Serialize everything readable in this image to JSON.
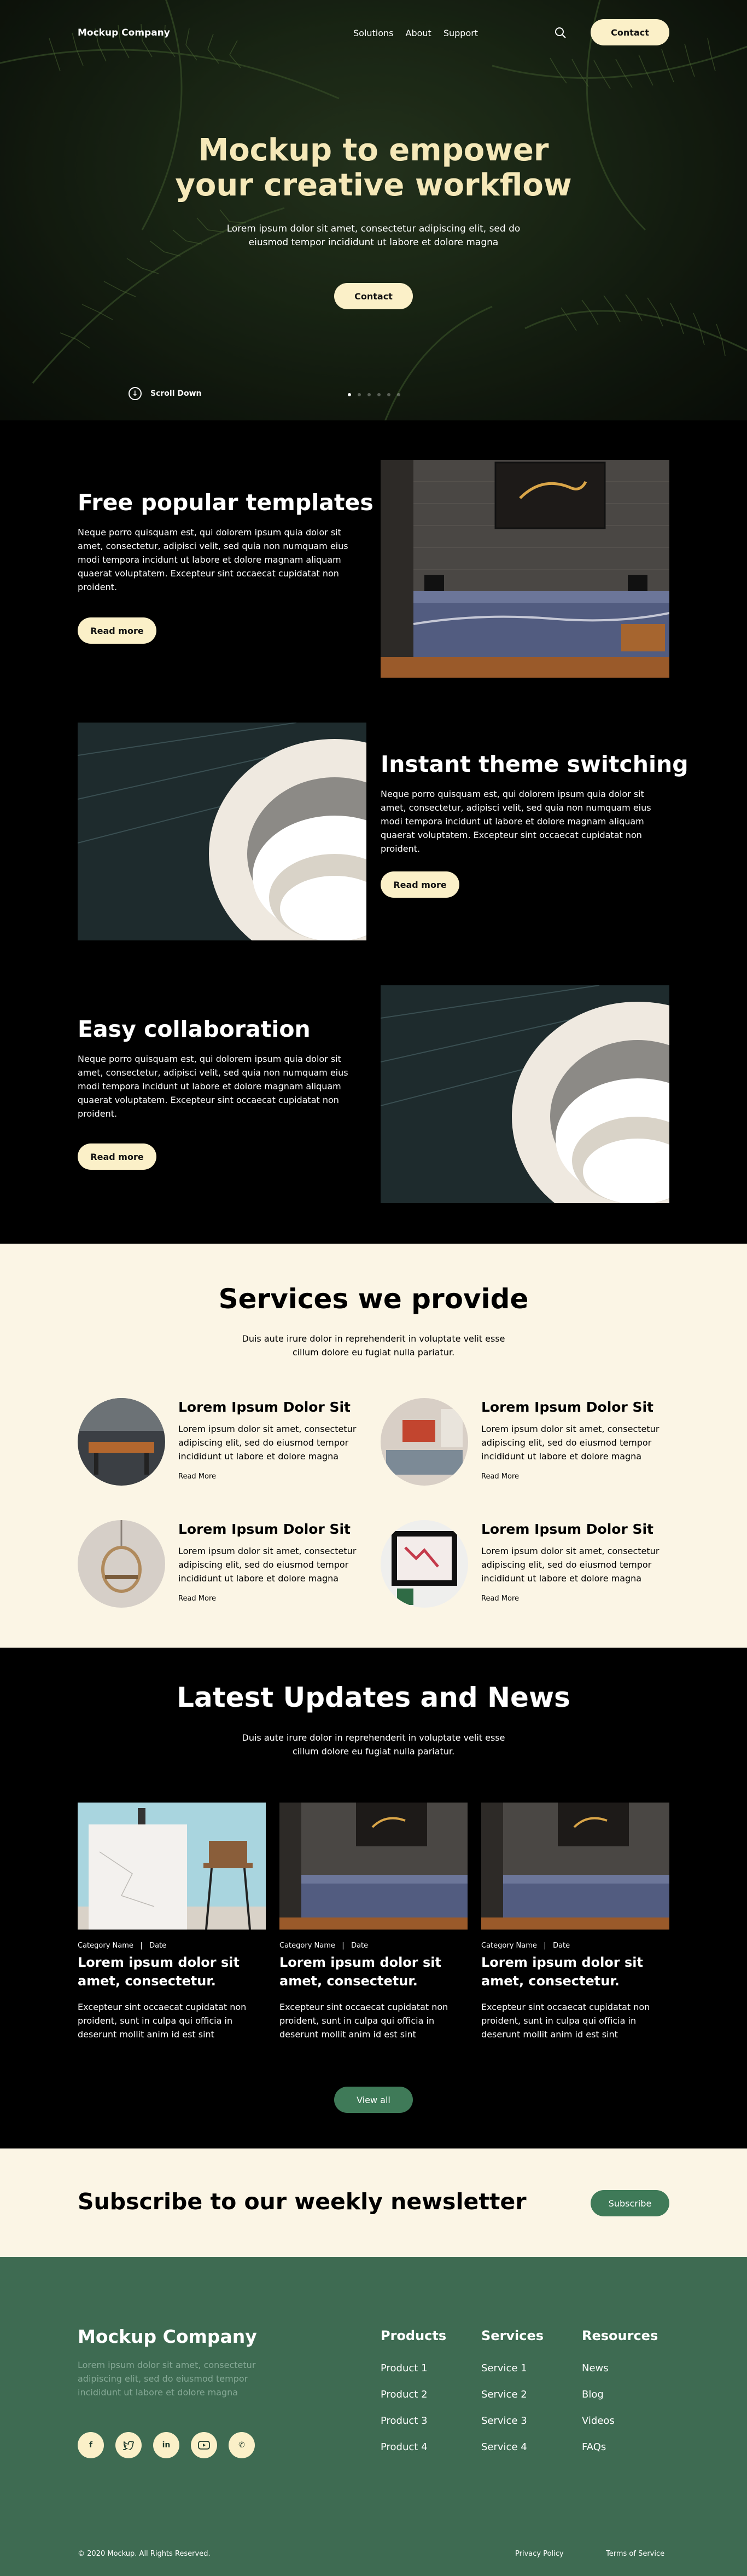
{
  "header": {
    "brand": "Mockup Company",
    "menu": [
      "Solutions",
      "About",
      "Support"
    ],
    "contact_label": "Contact"
  },
  "hero": {
    "title": "Mockup to empower your creative workflow",
    "subtitle": "Lorem ipsum dolor sit amet, consectetur adipiscing elit, sed do eiusmod tempor incididunt ut labore et dolore magna",
    "cta_label": "Contact",
    "scroll_label": "Scroll Down",
    "slides": 6,
    "active_slide": 1
  },
  "features": [
    {
      "title": "Free popular templates",
      "text": "Neque porro quisquam est, qui dolorem ipsum quia dolor sit amet, consectetur, adipisci velit, sed quia non numquam eius modi tempora incidunt ut labore et dolore magnam aliquam quaerat voluptatem. Excepteur sint occaecat cupidatat non proident.",
      "button": "Read more"
    },
    {
      "title": "Instant theme switching",
      "text": "Neque porro quisquam est, qui dolorem ipsum quia dolor sit amet, consectetur, adipisci velit, sed quia non numquam eius modi tempora incidunt ut labore et dolore magnam aliquam quaerat voluptatem. Excepteur sint occaecat cupidatat non proident.",
      "button": "Read more"
    },
    {
      "title": "Easy collaboration",
      "text": "Neque porro quisquam est, qui dolorem ipsum quia dolor sit amet, consectetur, adipisci velit, sed quia non numquam eius modi tempora incidunt ut labore et dolore magnam aliquam quaerat voluptatem. Excepteur sint occaecat cupidatat non proident.",
      "button": "Read more"
    }
  ],
  "services": {
    "title": "Services we provide",
    "subtitle": "Duis aute irure dolor in reprehenderit in voluptate velit esse cillum dolore eu fugiat nulla pariatur.",
    "items": [
      {
        "title": "Lorem Ipsum Dolor Sit",
        "text": "Lorem ipsum dolor sit amet, consectetur adipiscing elit, sed do eiusmod tempor incididunt ut labore et dolore magna",
        "link": "Read More"
      },
      {
        "title": "Lorem Ipsum Dolor Sit",
        "text": "Lorem ipsum dolor sit amet, consectetur adipiscing elit, sed do eiusmod tempor incididunt ut labore et dolore magna",
        "link": "Read More"
      },
      {
        "title": "Lorem Ipsum Dolor Sit",
        "text": "Lorem ipsum dolor sit amet, consectetur adipiscing elit, sed do eiusmod tempor incididunt ut labore et dolore magna",
        "link": "Read More"
      },
      {
        "title": "Lorem Ipsum Dolor Sit",
        "text": "Lorem ipsum dolor sit amet, consectetur adipiscing elit, sed do eiusmod tempor incididunt ut labore et dolore magna",
        "link": "Read More"
      }
    ]
  },
  "news": {
    "title": "Latest Updates and News",
    "subtitle": "Duis aute irure dolor in reprehenderit in voluptate velit esse cillum dolore eu fugiat nulla pariatur.",
    "cards": [
      {
        "category": "Category Name",
        "date": "Date",
        "title": "Lorem ipsum dolor sit amet, consectetur.",
        "text": "Excepteur sint occaecat cupidatat non proident, sunt in culpa qui officia in deserunt mollit anim id est sint"
      },
      {
        "category": "Category Name",
        "date": "Date",
        "title": "Lorem ipsum dolor sit amet, consectetur.",
        "text": "Excepteur sint occaecat cupidatat non proident, sunt in culpa qui officia in deserunt mollit anim id est sint"
      },
      {
        "category": "Category Name",
        "date": "Date",
        "title": "Lorem ipsum dolor sit amet, consectetur.",
        "text": "Excepteur sint occaecat cupidatat non proident, sunt in culpa qui officia in deserunt mollit anim id est sint"
      }
    ],
    "view_all": "View all"
  },
  "newsletter": {
    "title": "Subscribe to our weekly newsletter",
    "button": "Subscribe"
  },
  "footer": {
    "brand": "Mockup Company",
    "description": "Lorem ipsum dolor sit amet, consectetur adipiscing elit, sed do eiusmod tempor incididunt ut labore et dolore magna",
    "columns": [
      {
        "title": "Products",
        "links": [
          "Product 1",
          "Product 2",
          "Product 3",
          "Product 4"
        ]
      },
      {
        "title": "Services",
        "links": [
          "Service 1",
          "Service 2",
          "Service 3",
          "Service 4"
        ]
      },
      {
        "title": "Resources",
        "links": [
          "News",
          "Blog",
          "Videos",
          "FAQs"
        ]
      }
    ],
    "socials": [
      "facebook-icon",
      "twitter-icon",
      "linkedin-icon",
      "youtube-icon",
      "phone-icon"
    ],
    "copyright": "© 2020 Mockup.  All Rights Reserved.",
    "privacy": "Privacy Policy",
    "terms": "Terms of Service"
  },
  "colors": {
    "cream": "#fbf0c8",
    "light_bg": "#fbf5e5",
    "green": "#3f7a58",
    "footer_green": "#3e6b52",
    "hero_title": "#f5e8b8"
  }
}
